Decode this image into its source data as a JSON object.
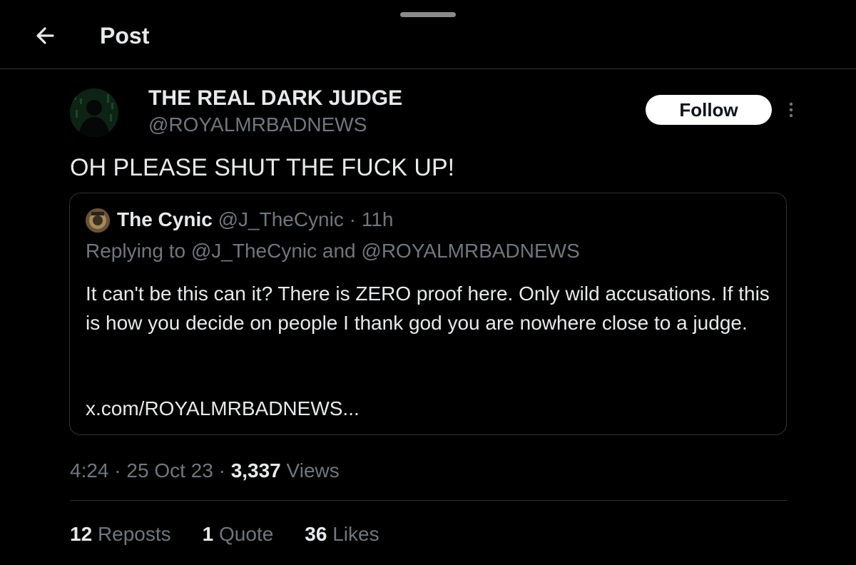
{
  "header": {
    "title": "Post",
    "back_icon": "arrow-left-icon"
  },
  "post": {
    "author_name": "THE REAL DARK JUDGE",
    "author_handle": "@ROYALMRBADNEWS",
    "follow_label": "Follow",
    "more_icon": "more-vertical-icon",
    "text": "OH PLEASE SHUT THE FUCK UP!",
    "time": "4:24",
    "date": "25 Oct 23",
    "views_count": "3,337",
    "views_label": "Views"
  },
  "quote": {
    "author_name": "The Cynic",
    "author_handle": "@J_TheCynic",
    "age": "11h",
    "replying_to": "Replying to @J_TheCynic and @ROYALMRBADNEWS",
    "body": "It can't be this can it? There is ZERO proof here. Only wild accusations. If this is how you decide on people I thank god you are nowhere close to a judge.",
    "link": "x.com/ROYALMRBADNEWS..."
  },
  "stats": {
    "reposts_count": "12",
    "reposts_label": "Reposts",
    "quotes_count": "1",
    "quotes_label": "Quote",
    "likes_count": "36",
    "likes_label": "Likes"
  },
  "colors": {
    "background": "#000000",
    "text_primary": "#e7e9ea",
    "text_secondary": "#71767b",
    "border": "#2f3336",
    "follow_button_bg": "#ffffff"
  }
}
